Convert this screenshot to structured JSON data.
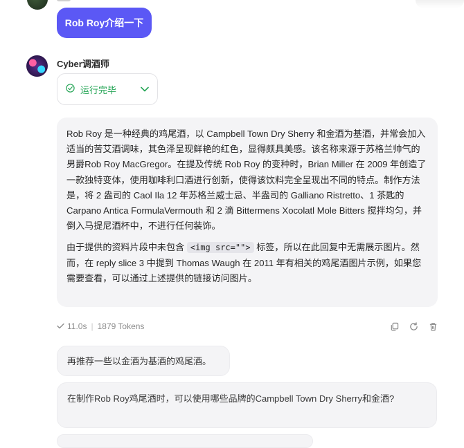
{
  "user_message": "Rob Roy介绍一下",
  "bot": {
    "name": "Cyber调酒师"
  },
  "status": {
    "label": "运行完毕"
  },
  "answer": {
    "p1": "Rob Roy 是一种经典的鸡尾酒，以 Campbell Town Dry Sherry 和金酒为基酒，并常会加入适当的苦艾酒调味，其色泽呈现鲜艳的红色，显得颇具美感。该名称来源于苏格兰帅气的男爵Rob Roy MacGregor。在提及传统 Rob Roy 的变种时，Brian Miller 在 2009 年创造了一款独特变体，使用咖啡利口酒进行创新，使得该饮料完全呈现出不同的特点。制作方法是，将 2 盎司的 Caol Ila 12 年苏格兰威士忌、半盎司的 Galliano Ristretto、1 茶匙的 Carpano Antica FormulaVermouth 和 2 滴 Bittermens Xocolatl Mole Bitters 搅拌均匀，并倒入马提尼酒杯中，不进行任何装饰。",
    "p2_before": "由于提供的资料片段中未包含 ",
    "p2_code": "<img src=\"\">",
    "p2_after": " 标签，所以在此回复中无需展示图片。然而，在 reply slice 3 中提到 Thomas Waugh 在 2011 年有相关的鸡尾酒图片示例，如果您需要查看，可以通过上述提供的链接访问图片。"
  },
  "meta": {
    "time": "11.0s",
    "tokens": "1879 Tokens"
  },
  "suggestions": [
    "再推荐一些以金酒为基酒的鸡尾酒。",
    "在制作Rob Roy鸡尾酒时，可以使用哪些品牌的Campbell Town Dry Sherry和金酒?"
  ],
  "icons": {
    "status": "check-circle-icon",
    "expand": "chevron-down-icon",
    "copy": "copy-icon",
    "regenerate": "refresh-icon",
    "delete": "trash-icon"
  },
  "colors": {
    "accent": "#5b58f5",
    "success": "#25a556",
    "bubble": "#f4f4f6"
  }
}
